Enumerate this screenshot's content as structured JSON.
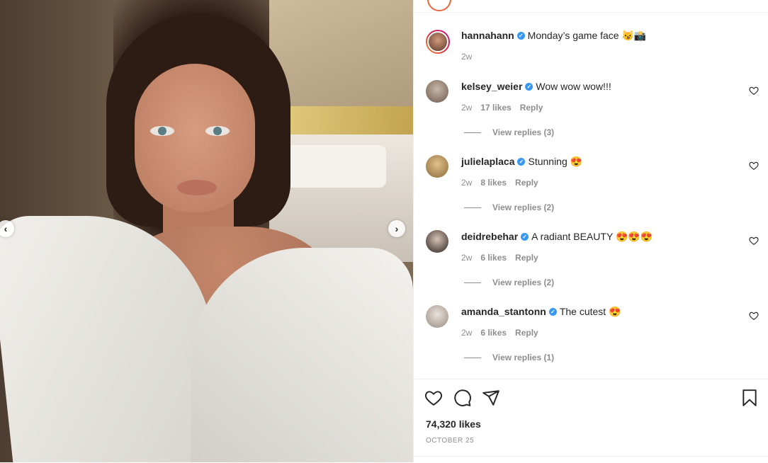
{
  "post": {
    "author": "hannahann",
    "caption": "Monday’s game face 😼📸",
    "time": "2w"
  },
  "comments": [
    {
      "user": "kelsey_weier",
      "text": "Wow wow wow!!!",
      "time": "2w",
      "likes": "17 likes",
      "reply": "Reply",
      "view_replies": "View replies (3)"
    },
    {
      "user": "julielaplaca",
      "text": "Stunning 😍",
      "time": "2w",
      "likes": "8 likes",
      "reply": "Reply",
      "view_replies": "View replies (2)"
    },
    {
      "user": "deidrebehar",
      "text": "A radiant BEAUTY 😍😍😍",
      "time": "2w",
      "likes": "6 likes",
      "reply": "Reply",
      "view_replies": "View replies (2)"
    },
    {
      "user": "amanda_stantonn",
      "text": "The cutest 😍",
      "time": "2w",
      "likes": "6 likes",
      "reply": "Reply",
      "view_replies": "View replies (1)"
    }
  ],
  "stats": {
    "likes": "74,320 likes",
    "date": "OCTOBER 25"
  },
  "icons": {
    "like": "heart-icon",
    "comment": "comment-icon",
    "share": "paper-plane-icon",
    "save": "bookmark-icon",
    "prev": "chevron-left-icon",
    "next": "chevron-right-icon",
    "verified": "verified-badge-icon"
  },
  "colors": {
    "verified": "#3897f0",
    "text": "#262626",
    "muted": "#8e8e8e"
  }
}
